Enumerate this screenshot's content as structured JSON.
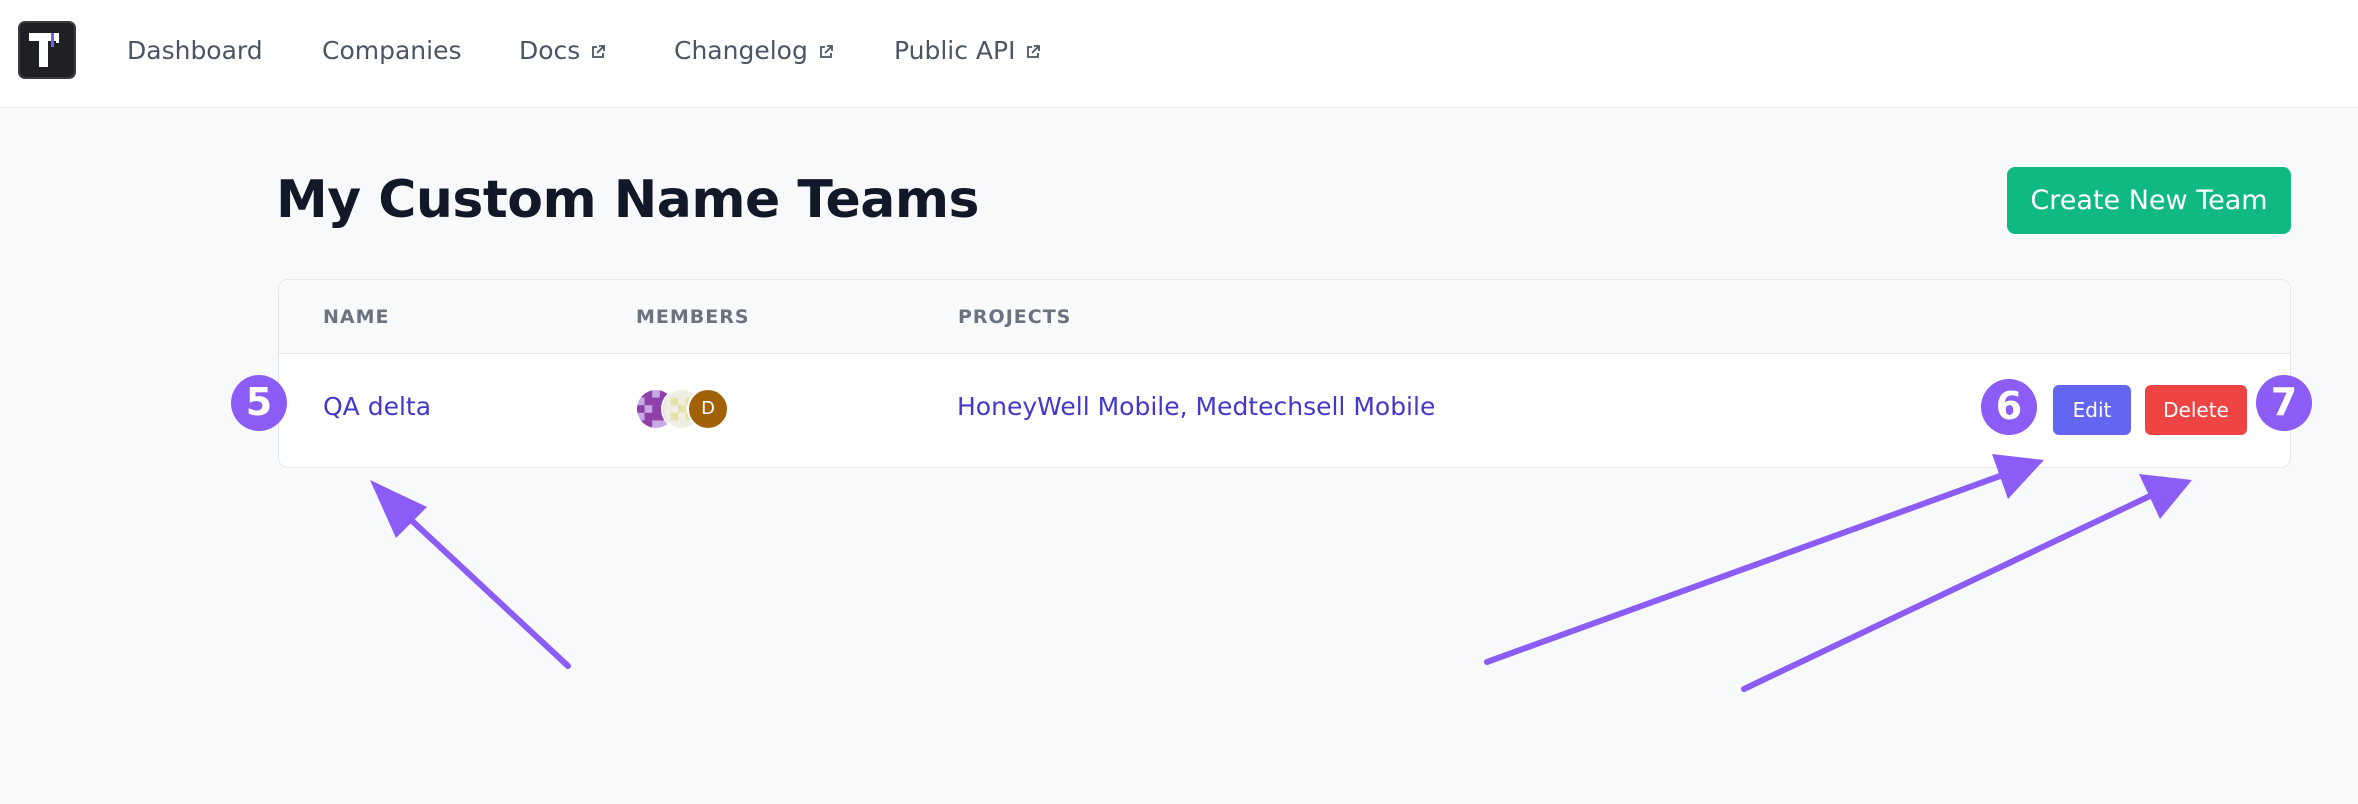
{
  "nav": {
    "logo_icon": "app-logo",
    "links": [
      {
        "label": "Dashboard",
        "external": false
      },
      {
        "label": "Companies",
        "external": false
      },
      {
        "label": "Docs",
        "external": true
      },
      {
        "label": "Changelog",
        "external": true
      },
      {
        "label": "Public API",
        "external": true
      }
    ]
  },
  "page": {
    "title": "My Custom Name Teams",
    "create_button": "Create New Team"
  },
  "table": {
    "headers": [
      "NAME",
      "MEMBERS",
      "PROJECTS"
    ],
    "rows": [
      {
        "name": "QA delta",
        "members": [
          {
            "avatar": "pixel-avatar-purple"
          },
          {
            "avatar": "pixel-avatar-cream"
          },
          {
            "avatar": "letter-avatar",
            "initial": "D"
          }
        ],
        "projects": "HoneyWell Mobile, Medtechsell Mobile",
        "edit_label": "Edit",
        "delete_label": "Delete"
      }
    ]
  },
  "annotations": {
    "steps": [
      "5",
      "6",
      "7"
    ],
    "color": "#8b5cf6"
  },
  "colors": {
    "primary_green": "#10b981",
    "edit_indigo": "#6366f1",
    "delete_red": "#ef4444",
    "link_indigo": "#4338ca"
  }
}
